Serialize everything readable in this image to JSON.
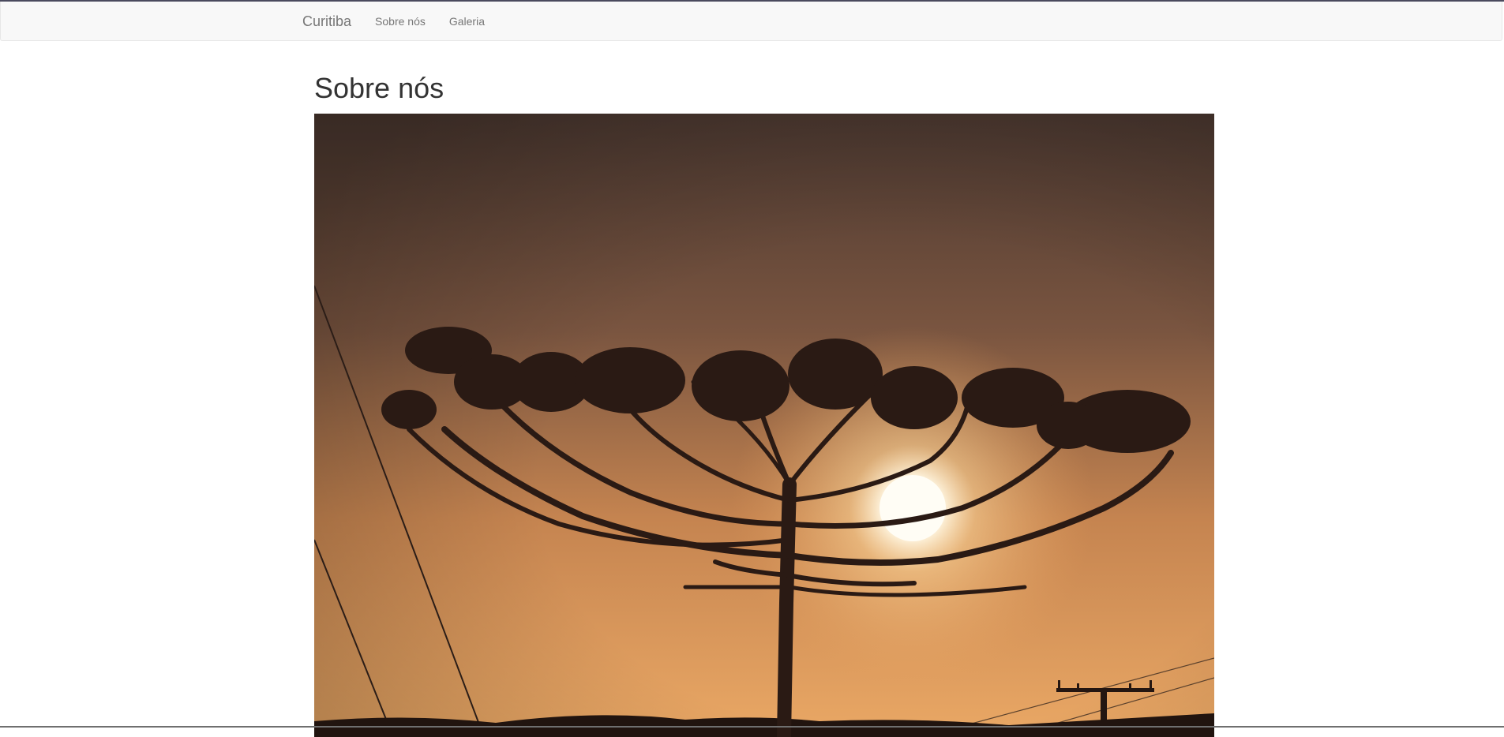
{
  "navbar": {
    "brand": "Curitiba",
    "links": [
      {
        "label": "Sobre nós"
      },
      {
        "label": "Galeria"
      }
    ]
  },
  "main": {
    "title": "Sobre nós",
    "hero_image": {
      "subject": "araucaria-tree-sunset-photo"
    }
  },
  "colors": {
    "navbar_bg": "#f8f8f8",
    "navbar_text": "#777777",
    "title_text": "#333333",
    "sky_top": "#4f3a30",
    "sky_bottom": "#e6a25e",
    "silhouette": "#2a1a14"
  }
}
